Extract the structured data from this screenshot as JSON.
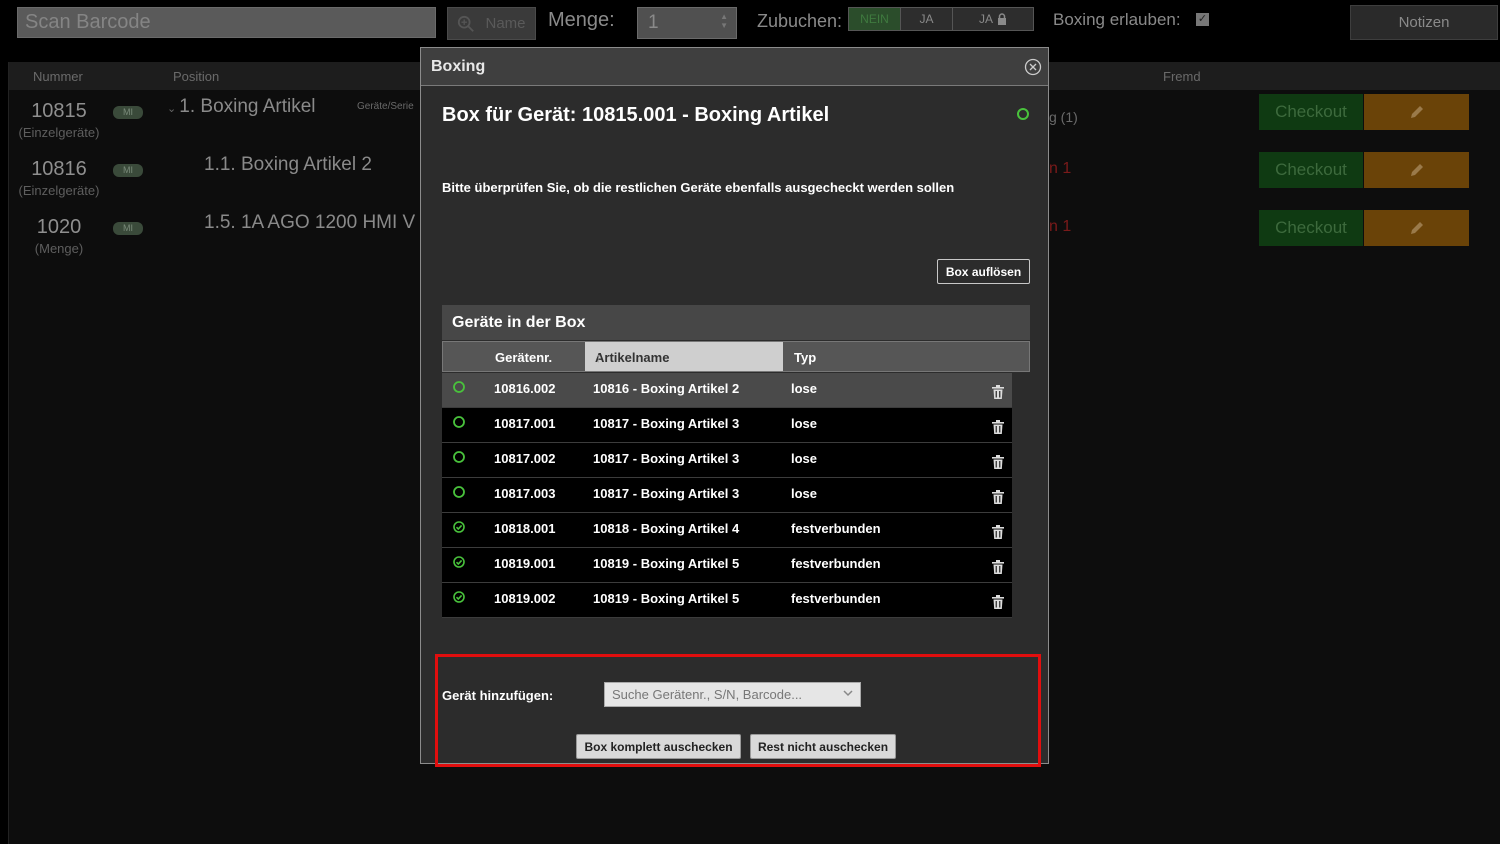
{
  "topbar": {
    "scan_placeholder": "Scan Barcode",
    "name_button": "Name",
    "menge_label": "Menge:",
    "menge_value": "1",
    "zubuchen_label": "Zubuchen:",
    "zubuchen_options": [
      "NEIN",
      "JA",
      "JA"
    ],
    "boxing_label": "Boxing erlauben:",
    "notizen_button": "Notizen"
  },
  "background_table": {
    "headers": {
      "nummer": "Nummer",
      "position": "Position",
      "fremd": "Fremd"
    },
    "rows": [
      {
        "number": "10815",
        "subtype": "(Einzelgeräte)",
        "badge": "MI",
        "position": "1.  Boxing Artikel",
        "position_sub": "Geräte/Serie",
        "fremd": "g (1)",
        "checkout": "Checkout"
      },
      {
        "number": "10816",
        "subtype": "(Einzelgeräte)",
        "badge": "MI",
        "position": "1.1.  Boxing Artikel 2",
        "fremd": "n 1",
        "checkout": "Checkout"
      },
      {
        "number": "1020",
        "subtype": "(Menge)",
        "badge": "MI",
        "position": "1.5.  1A AGO 1200 HMI V",
        "fremd": "n 1",
        "checkout": "Checkout"
      }
    ]
  },
  "modal": {
    "header": "Boxing",
    "title": "Box für Gerät: 10815.001 - Boxing Artikel",
    "info": "Bitte überprüfen Sie, ob die restlichen Geräte ebenfalls ausgecheckt werden sollen",
    "box_aufloesen": "Box auflösen",
    "panel_title": "Geräte in der Box",
    "columns": {
      "geraetenr": "Gerätenr.",
      "artikelname": "Artikelname",
      "typ": "Typ"
    },
    "rows": [
      {
        "nr": "10816.002",
        "artikel": "10816 - Boxing Artikel 2",
        "typ": "lose",
        "checked": false
      },
      {
        "nr": "10817.001",
        "artikel": "10817 - Boxing Artikel 3",
        "typ": "lose",
        "checked": false
      },
      {
        "nr": "10817.002",
        "artikel": "10817 - Boxing Artikel 3",
        "typ": "lose",
        "checked": false
      },
      {
        "nr": "10817.003",
        "artikel": "10817 - Boxing Artikel 3",
        "typ": "lose",
        "checked": false
      },
      {
        "nr": "10818.001",
        "artikel": "10818 - Boxing Artikel 4",
        "typ": "festverbunden",
        "checked": true
      },
      {
        "nr": "10819.001",
        "artikel": "10819 - Boxing Artikel 5",
        "typ": "festverbunden",
        "checked": true
      },
      {
        "nr": "10819.002",
        "artikel": "10819 - Boxing Artikel 5",
        "typ": "festverbunden",
        "checked": true
      }
    ],
    "add_label": "Gerät hinzufügen:",
    "search_placeholder": "Suche Gerätenr., S/N, Barcode...",
    "btn_komplett": "Box komplett auschecken",
    "btn_rest": "Rest nicht auschecken"
  },
  "colors": {
    "status_green": "#49c23c",
    "highlight_red": "#e10e0e",
    "checkout_green": "#0f3a12",
    "edit_orange": "#6a4308"
  }
}
